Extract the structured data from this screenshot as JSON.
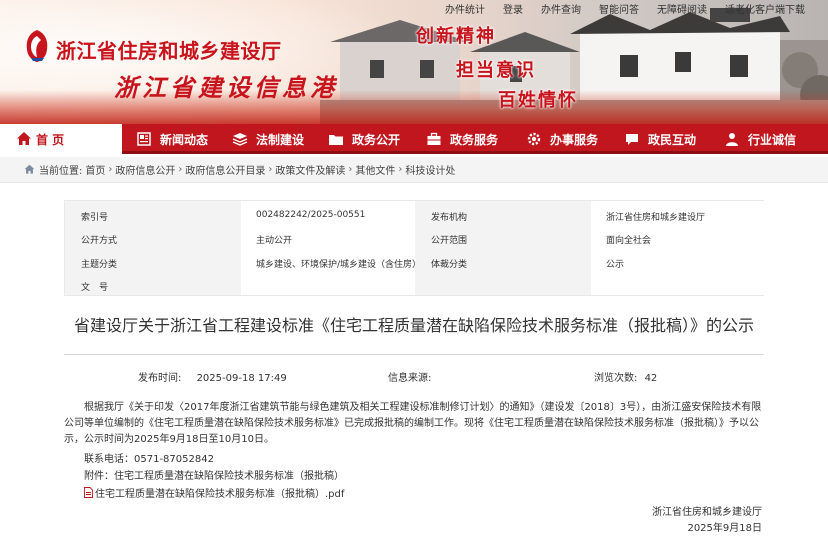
{
  "top_links": [
    "办件统计",
    "登录",
    "办件查询",
    "智能问答",
    "无障碍阅读",
    "适老化客户端下载"
  ],
  "site": {
    "title": "浙江省住房和城乡建设厅",
    "subtitle": "浙江省建设信息港",
    "slogans": [
      "创新精神",
      "担当意识",
      "百姓情怀"
    ]
  },
  "nav": {
    "items": [
      {
        "label": "首 页",
        "icon": "home-icon"
      },
      {
        "label": "新闻动态",
        "icon": "newspaper-icon"
      },
      {
        "label": "法制建设",
        "icon": "layers-icon"
      },
      {
        "label": "政务公开",
        "icon": "folder-icon"
      },
      {
        "label": "政务服务",
        "icon": "briefcase-icon"
      },
      {
        "label": "办事服务",
        "icon": "gear-icon"
      },
      {
        "label": "政民互动",
        "icon": "chat-icon"
      },
      {
        "label": "行业诚信",
        "icon": "person-icon"
      }
    ]
  },
  "breadcrumb": {
    "prefix": "当前位置:",
    "items": [
      "首页",
      "政府信息公开",
      "政府信息公开目录",
      "政策文件及解读",
      "其他文件",
      "科技设计处"
    ]
  },
  "meta": {
    "rows": [
      {
        "k1": "索引号",
        "v1": "002482242/2025-00551",
        "k2": "发布机构",
        "v2": "浙江省住房和城乡建设厅"
      },
      {
        "k1": "公开方式",
        "v1": "主动公开",
        "k2": "公开范围",
        "v2": "面向全社会"
      },
      {
        "k1": "主题分类",
        "v1": "城乡建设、环境保护/城乡建设（含住房）",
        "k2": "体裁分类",
        "v2": "公示"
      },
      {
        "k1": "文　号",
        "v1": "",
        "k2": "",
        "v2": ""
      }
    ]
  },
  "article": {
    "title": "省建设厅关于浙江省工程建设标准《住宅工程质量潜在缺陷保险技术服务标准（报批稿）》的公示",
    "publish_time_label": "发布时间:",
    "publish_time": "2025-09-18 17:49",
    "source_label": "信息来源:",
    "source": "",
    "views_label": "浏览次数:",
    "views": "42",
    "paragraph": "根据我厅《关于印发〈2017年度浙江省建筑节能与绿色建筑及相关工程建设标准制修订计划〉的通知》（建设发〔2018〕3号），由浙江盛安保险技术有限公司等单位编制的《住宅工程质量潜在缺陷保险技术服务标准》已完成报批稿的编制工作。现将《住宅工程质量潜在缺陷保险技术服务标准（报批稿）》予以公示，公示时间为2025年9月18日至10月10日。",
    "phone_line": "联系电话：0571-87052842",
    "attachment_line": "附件：住宅工程质量潜在缺陷保险技术服务标准（报批稿）",
    "attachment_file": "住宅工程质量潜在缺陷保险技术服务标准（报批稿）.pdf",
    "signature": "浙江省住房和城乡建设厅",
    "date": "2025年9月18日"
  },
  "colors": {
    "brand_red": "#c1161d",
    "nav_dark": "#8d0d12"
  }
}
